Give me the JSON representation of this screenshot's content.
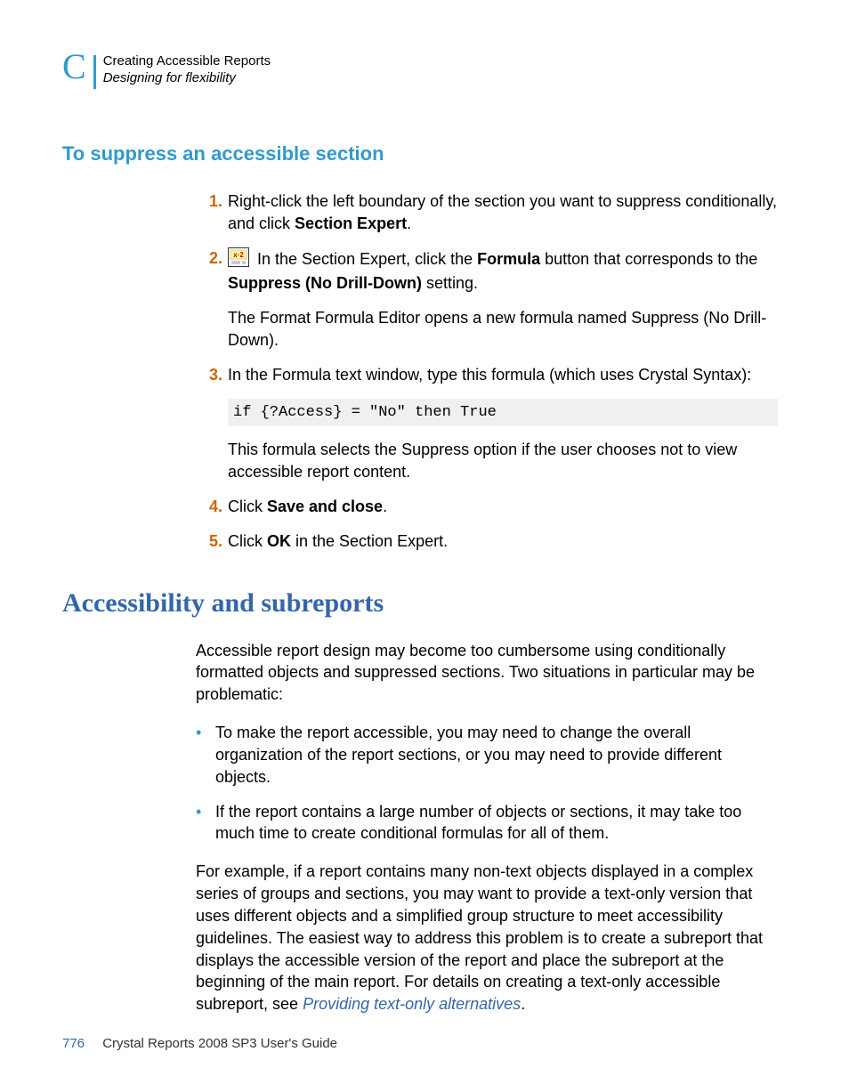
{
  "header": {
    "appendix_letter": "C",
    "chapter": "Creating Accessible Reports",
    "section": "Designing for flexibility"
  },
  "section1": {
    "heading": "To suppress an accessible section",
    "step1": {
      "num": "1.",
      "text_a": "Right-click the left boundary of the section you want to suppress conditionally, and click ",
      "bold_a": "Section Expert",
      "text_b": "."
    },
    "step2": {
      "num": "2.",
      "text_a": " In the Section Expert, click the ",
      "bold_a": "Formula",
      "text_b": " button that corresponds to the ",
      "bold_b": "Suppress (No Drill-Down)",
      "text_c": " setting.",
      "para2": "The Format Formula Editor opens a new formula named Suppress (No Drill-Down)."
    },
    "step3": {
      "num": "3.",
      "text": "In the Formula text window, type this formula (which uses Crystal Syntax):",
      "code": "if {?Access} = \"No\" then True",
      "para2": "This formula selects the Suppress option if the user chooses not to view accessible report content."
    },
    "step4": {
      "num": "4.",
      "text_a": "Click ",
      "bold_a": "Save and close",
      "text_b": "."
    },
    "step5": {
      "num": "5.",
      "text_a": "Click ",
      "bold_a": "OK",
      "text_b": " in the Section Expert."
    }
  },
  "section2": {
    "heading": "Accessibility and subreports",
    "para1": "Accessible report design may become too cumbersome using conditionally formatted objects and suppressed sections. Two situations in particular may be problematic:",
    "bullet1": "To make the report accessible, you may need to change the overall organization of the report sections, or you may need to provide different objects.",
    "bullet2": "If the report contains a large number of objects or sections, it may take too much time to create conditional formulas for all of them.",
    "para2_a": "For example, if a report contains many non-text objects displayed in a complex series of groups and sections, you may want to provide a text-only version that uses different objects and a simplified group structure to meet accessibility guidelines. The easiest way to address this problem is to create a subreport that displays the accessible version of the report and place the subreport at the beginning of the main report. For details on creating a text-only accessible subreport, see ",
    "link": "Providing text-only alternatives",
    "para2_b": "."
  },
  "footer": {
    "page": "776",
    "title": "Crystal Reports 2008 SP3 User's Guide"
  }
}
